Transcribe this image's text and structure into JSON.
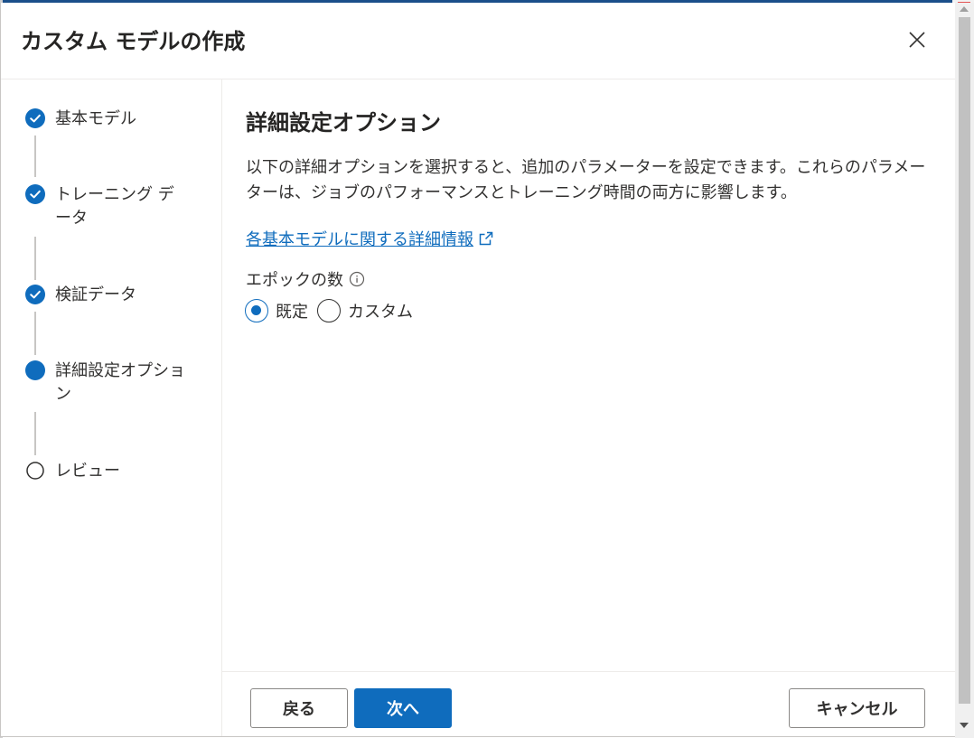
{
  "dialog": {
    "title": "カスタム モデルの作成",
    "close_label": "閉じる"
  },
  "steps": [
    {
      "label": "基本モデル",
      "status": "completed"
    },
    {
      "label": "トレーニング データ",
      "status": "completed"
    },
    {
      "label": "検証データ",
      "status": "completed"
    },
    {
      "label": "詳細設定オプション",
      "status": "current"
    },
    {
      "label": "レビュー",
      "status": "pending"
    }
  ],
  "content": {
    "title": "詳細設定オプション",
    "description": "以下の詳細オプションを選択すると、追加のパラメーターを設定できます。これらのパラメーターは、ジョブのパフォーマンスとトレーニング時間の両方に影響します。",
    "link_text": "各基本モデルに関する詳細情報",
    "epochs": {
      "label": "エポックの数",
      "options": [
        {
          "label": "既定",
          "selected": true
        },
        {
          "label": "カスタム",
          "selected": false
        }
      ]
    }
  },
  "footer": {
    "back_label": "戻る",
    "next_label": "次へ",
    "cancel_label": "キャンセル"
  },
  "colors": {
    "accent": "#0f6cbd",
    "text": "#323130",
    "border": "#8a8886"
  },
  "icons": {
    "completed": "checkmark-circle-icon",
    "current": "filled-circle-icon",
    "pending": "empty-circle-icon",
    "link": "open-external-icon",
    "info": "info-icon",
    "close": "close-icon"
  }
}
